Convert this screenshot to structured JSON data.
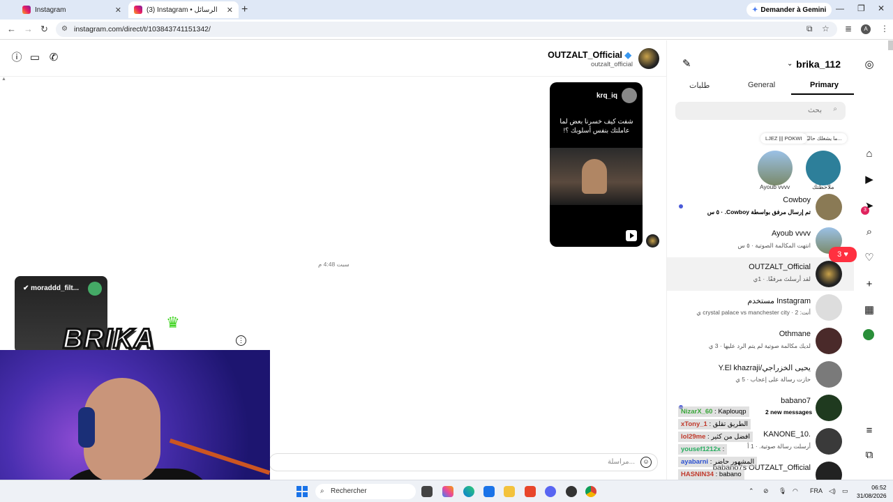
{
  "browser": {
    "tabs": [
      {
        "title": "Instagram"
      },
      {
        "title": "(3) Instagram • الرسائل"
      }
    ],
    "gemini_label": "Demander à Gemini",
    "url": "instagram.com/direct/t/103843741151342/",
    "profile_initial": "A"
  },
  "chat": {
    "contact_name": "OUTZALT_Official",
    "contact_username": "outzalt_official",
    "shared_reel": {
      "username": "krq_iq",
      "caption": "شفت كيف خسرنا بعض لما عاملتك بنفس أسلوبك ؟!"
    },
    "timestamp": "سبت 4:48 م",
    "input_placeholder": "مراسلة..."
  },
  "overlays": {
    "mini_video_user": "moraddd_filt...",
    "logo_text": "BRIKA"
  },
  "dm_panel": {
    "account": "brika_112",
    "tabs": {
      "primary": "Primary",
      "general": "General",
      "requests": "طلبات"
    },
    "search_placeholder": "بحث",
    "notes": [
      {
        "text": "ما يشغلك حاليًا...",
        "name": "ملاحظتك"
      },
      {
        "text": "LJEZ ||| POKWI",
        "name": "Ayoub vvvv"
      }
    ],
    "conversations": [
      {
        "name": "Cowboy",
        "preview": "تم إرسال مرفق بواسطة Cowboy. · ٥ س",
        "unread": true
      },
      {
        "name": "Ayoub vvvv",
        "preview": "انتهت المكالمة الصوتية · ٥ س",
        "unread": false
      },
      {
        "name": "OUTZALT_Official",
        "preview": "لقد أرسلتَ مرفقًا. · 1ي",
        "unread": false,
        "selected": true
      },
      {
        "name": "مستخدم Instagram",
        "preview": "أنت: crystal palace vs manchester city · 2 ي",
        "unread": false
      },
      {
        "name": "Othmane",
        "preview": "لديك مكالمة صوتية لم يتم الرد عليها · 3 ي",
        "unread": false
      },
      {
        "name": "Y.El khazraji/يحيى الخزراجي",
        "preview": "حازت رسالة على إعجاب · 5 ي",
        "unread": false
      },
      {
        "name": "babano7",
        "preview": "",
        "unread": true
      },
      {
        "name": "KANONE_10.",
        "preview": "أرسلت رسالة صوتية. · 1 أ",
        "unread": false
      },
      {
        "name": "babano7s OUTZALT_Official",
        "preview": "",
        "unread": false
      }
    ]
  },
  "rail": {
    "messages_badge": "3",
    "notif_count": "3"
  },
  "stream_chat": {
    "new_messages": "2 new messages",
    "lines": [
      {
        "user": "NizarX_60",
        "text": "Kaplouqp",
        "color": "#3aa63a"
      },
      {
        "user": "xTony_1",
        "text": "الطريق تقلق",
        "color": "#c0392b"
      },
      {
        "user": "lol29me",
        "text": "افضل من كثير",
        "color": "#c0392b"
      },
      {
        "user": "yousef1212x",
        "text": "",
        "color": "#27ae60"
      },
      {
        "user": "ayabarni",
        "text": "المشهور حاضر",
        "color": "#2a4fd0"
      },
      {
        "user": "HASNIN34",
        "text": "babano",
        "color": "#c0392b"
      }
    ]
  },
  "taskbar": {
    "search_label": "Rechercher",
    "lang": "FRA",
    "time": "06:52",
    "date": "31/08/2026"
  },
  "colors": {
    "accent": "#4a5ad8",
    "notif": "#ff3040",
    "tabbar": "#dfe8f6"
  }
}
